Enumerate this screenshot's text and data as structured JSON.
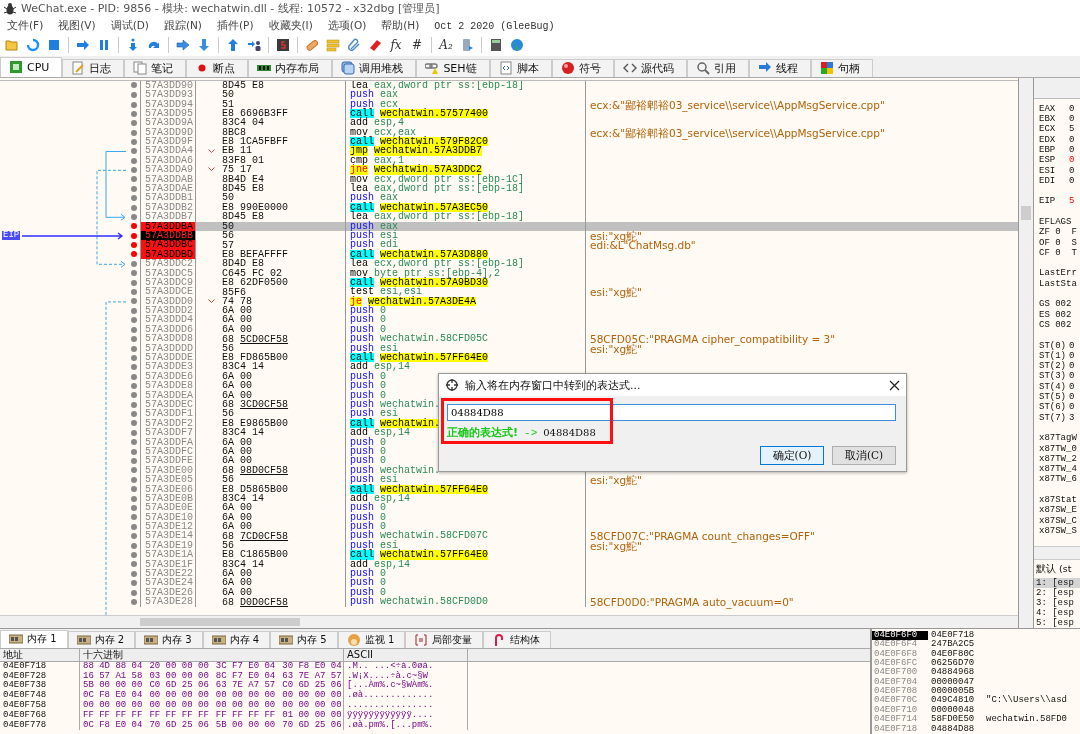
{
  "window": {
    "title": "WeChat.exe - PID: 9856 - 模块: wechatwin.dll - 线程: 10572 - x32dbg [管理员]"
  },
  "menu": [
    "文件(F)",
    "视图(V)",
    "调试(D)",
    "跟踪(N)",
    "插件(P)",
    "收藏夹(I)",
    "选项(O)",
    "帮助(H)"
  ],
  "build": "Oct 2 2020 (GleeBug)",
  "toolbar": [
    {
      "kind": "open"
    },
    {
      "kind": "restart"
    },
    {
      "kind": "stop"
    },
    {
      "kind": "sep"
    },
    {
      "kind": "run"
    },
    {
      "kind": "pause"
    },
    {
      "kind": "sep"
    },
    {
      "kind": "stepinto"
    },
    {
      "kind": "stepover"
    },
    {
      "kind": "sep"
    },
    {
      "kind": "traceinto"
    },
    {
      "kind": "traceover"
    },
    {
      "kind": "sep"
    },
    {
      "kind": "return"
    },
    {
      "kind": "user"
    },
    {
      "kind": "sep"
    },
    {
      "kind": "scriptbox"
    },
    {
      "kind": "sep"
    },
    {
      "kind": "patch"
    },
    {
      "kind": "comments"
    },
    {
      "kind": "labels"
    },
    {
      "kind": "bookmarks"
    },
    {
      "kind": "glyph",
      "label": "fx"
    },
    {
      "kind": "glyph",
      "label": "#"
    },
    {
      "kind": "sep"
    },
    {
      "kind": "glyph",
      "label": "A₂"
    },
    {
      "kind": "device"
    },
    {
      "kind": "sep"
    },
    {
      "kind": "calculator"
    },
    {
      "kind": "globe"
    }
  ],
  "tabs": [
    {
      "label": "CPU",
      "kind": "cpu",
      "selected": true
    },
    {
      "label": "日志",
      "kind": "log",
      "selected": false
    },
    {
      "label": "笔记",
      "kind": "notes",
      "selected": false
    },
    {
      "label": "断点",
      "kind": "breakpoints",
      "selected": false
    },
    {
      "label": "内存布局",
      "kind": "memmap",
      "selected": false
    },
    {
      "label": "调用堆栈",
      "kind": "callstack",
      "selected": false
    },
    {
      "label": "SEH链",
      "kind": "seh",
      "selected": false
    },
    {
      "label": "脚本",
      "kind": "script",
      "selected": false
    },
    {
      "label": "符号",
      "kind": "symbols",
      "selected": false
    },
    {
      "label": "源代码",
      "kind": "source",
      "selected": false
    },
    {
      "label": "引用",
      "kind": "references",
      "selected": false
    },
    {
      "label": "线程",
      "kind": "threads",
      "selected": false
    },
    {
      "label": "句柄",
      "kind": "handles",
      "selected": false
    }
  ],
  "disassembly": {
    "eip_label": "EIP",
    "rows": [
      {
        "address": "57A3DD90",
        "bytes": "8D45 E8",
        "mnemonic": "lea",
        "operands": "eax,dword ptr ss:[ebp-18]",
        "kind": "plain",
        "breakpoint": false,
        "selected": false,
        "eip": false
      },
      {
        "address": "57A3DD93",
        "bytes": "50",
        "mnemonic": "push",
        "operands": "eax",
        "kind": "push",
        "breakpoint": false,
        "selected": false,
        "eip": false
      },
      {
        "address": "57A3DD94",
        "bytes": "51",
        "mnemonic": "push",
        "operands": "ecx",
        "kind": "push",
        "breakpoint": false,
        "selected": false,
        "eip": false,
        "comment": "ecx:&\"鄙裕郫裕03_service\\\\service\\\\AppMsgService.cpp\""
      },
      {
        "address": "57A3DD95",
        "bytes": "E8 6696B3FF",
        "mnemonic": "call",
        "operands": "wechatwin.57577400",
        "kind": "call",
        "breakpoint": false,
        "selected": false,
        "eip": false
      },
      {
        "address": "57A3DD9A",
        "bytes": "83C4 04",
        "mnemonic": "add",
        "operands": "esp,4",
        "kind": "plain",
        "breakpoint": false,
        "selected": false,
        "eip": false
      },
      {
        "address": "57A3DD9D",
        "bytes": "8BC8",
        "mnemonic": "mov",
        "operands": "ecx,eax",
        "kind": "plain",
        "breakpoint": false,
        "selected": false,
        "eip": false,
        "comment": "ecx:&\"鄙裕郫裕03_service\\\\service\\\\AppMsgService.cpp\""
      },
      {
        "address": "57A3DD9F",
        "bytes": "E8 1CA5FBFF",
        "mnemonic": "call",
        "operands": "wechatwin.579F82C0",
        "kind": "call",
        "breakpoint": false,
        "selected": false,
        "eip": false
      },
      {
        "address": "57A3DDA4",
        "bytes": "EB 11",
        "mnemonic": "jmp",
        "operands": "wechatwin.57A3DDB7",
        "kind": "jmp",
        "breakpoint": false,
        "selected": false,
        "eip": false
      },
      {
        "address": "57A3DDA6",
        "bytes": "83F8 01",
        "mnemonic": "cmp",
        "operands": "eax,1",
        "kind": "plain",
        "breakpoint": false,
        "selected": false,
        "eip": false
      },
      {
        "address": "57A3DDA9",
        "bytes": "75 17",
        "mnemonic": "jne",
        "operands": "wechatwin.57A3DDC2",
        "kind": "jcc",
        "breakpoint": false,
        "selected": false,
        "eip": false
      },
      {
        "address": "57A3DDAB",
        "bytes": "8B4D E4",
        "mnemonic": "mov",
        "operands": "ecx,dword ptr ss:[ebp-1C]",
        "kind": "plain",
        "breakpoint": false,
        "selected": false,
        "eip": false
      },
      {
        "address": "57A3DDAE",
        "bytes": "8D45 E8",
        "mnemonic": "lea",
        "operands": "eax,dword ptr ss:[ebp-18]",
        "kind": "plain",
        "breakpoint": false,
        "selected": false,
        "eip": false
      },
      {
        "address": "57A3DDB1",
        "bytes": "50",
        "mnemonic": "push",
        "operands": "eax",
        "kind": "push",
        "breakpoint": false,
        "selected": false,
        "eip": false
      },
      {
        "address": "57A3DDB2",
        "bytes": "E8 990E0000",
        "mnemonic": "call",
        "operands": "wechatwin.57A3EC50",
        "kind": "call",
        "breakpoint": false,
        "selected": false,
        "eip": false
      },
      {
        "address": "57A3DDB7",
        "bytes": "8D45 E8",
        "mnemonic": "lea",
        "operands": "eax,dword ptr ss:[ebp-18]",
        "kind": "plain",
        "breakpoint": false,
        "selected": false,
        "eip": false
      },
      {
        "address": "57A3DDBA",
        "bytes": "50",
        "mnemonic": "push",
        "operands": "eax",
        "kind": "push",
        "breakpoint": true,
        "selected": true,
        "eip": false
      },
      {
        "address": "57A3DDBB",
        "bytes": "56",
        "mnemonic": "push",
        "operands": "esi",
        "kind": "push",
        "breakpoint": true,
        "selected": false,
        "eip": true,
        "comment": "esi:\"xg鮀\""
      },
      {
        "address": "57A3DDBC",
        "bytes": "57",
        "mnemonic": "push",
        "operands": "edi",
        "kind": "push",
        "breakpoint": true,
        "selected": false,
        "eip": false,
        "comment": "edi:&L\"ChatMsg.db\""
      },
      {
        "address": "57A3DDBD",
        "bytes": "E8 BEFAFFFF",
        "mnemonic": "call",
        "operands": "wechatwin.57A3D880",
        "kind": "call",
        "breakpoint": true,
        "selected": false,
        "eip": false
      },
      {
        "address": "57A3DDC2",
        "bytes": "8D4D E8",
        "mnemonic": "lea",
        "operands": "ecx,dword ptr ss:[ebp-18]",
        "kind": "plain",
        "breakpoint": false,
        "selected": false,
        "eip": false
      },
      {
        "address": "57A3DDC5",
        "bytes": "C645 FC 02",
        "mnemonic": "mov",
        "operands": "byte ptr ss:[ebp-4],2",
        "kind": "plain",
        "breakpoint": false,
        "selected": false,
        "eip": false
      },
      {
        "address": "57A3DDC9",
        "bytes": "E8 62DF0500",
        "mnemonic": "call",
        "operands": "wechatwin.57A9BD30",
        "kind": "call",
        "breakpoint": false,
        "selected": false,
        "eip": false
      },
      {
        "address": "57A3DDCE",
        "bytes": "85F6",
        "mnemonic": "test",
        "operands": "esi,esi",
        "kind": "plain",
        "breakpoint": false,
        "selected": false,
        "eip": false,
        "comment": "esi:\"xg鮀\""
      },
      {
        "address": "57A3DDD0",
        "bytes": "74 78",
        "mnemonic": "je",
        "operands": "wechatwin.57A3DE4A",
        "kind": "jcc",
        "breakpoint": false,
        "selected": false,
        "eip": false
      },
      {
        "address": "57A3DDD2",
        "bytes": "6A 00",
        "mnemonic": "push",
        "operands": "0",
        "kind": "push",
        "breakpoint": false,
        "selected": false,
        "eip": false
      },
      {
        "address": "57A3DDD4",
        "bytes": "6A 00",
        "mnemonic": "push",
        "operands": "0",
        "kind": "push",
        "breakpoint": false,
        "selected": false,
        "eip": false
      },
      {
        "address": "57A3DDD6",
        "bytes": "6A 00",
        "mnemonic": "push",
        "operands": "0",
        "kind": "push",
        "breakpoint": false,
        "selected": false,
        "eip": false
      },
      {
        "address": "57A3DDD8",
        "bytes": "68",
        "bytes_ref": "5CD0CF58",
        "mnemonic": "push",
        "operands": "wechatwin.58CFD05C",
        "kind": "push",
        "breakpoint": false,
        "selected": false,
        "eip": false,
        "comment": "58CFD05C:\"PRAGMA cipher_compatibility = 3\""
      },
      {
        "address": "57A3DDDD",
        "bytes": "56",
        "mnemonic": "push",
        "operands": "esi",
        "kind": "push",
        "breakpoint": false,
        "selected": false,
        "eip": false,
        "comment": "esi:\"xg鮀\""
      },
      {
        "address": "57A3DDDE",
        "bytes": "E8 FD865B00",
        "mnemonic": "call",
        "operands": "wechatwin.57FF64E0",
        "kind": "call",
        "breakpoint": false,
        "selected": false,
        "eip": false
      },
      {
        "address": "57A3DDE3",
        "bytes": "83C4 14",
        "mnemonic": "add",
        "operands": "esp,14",
        "kind": "plain",
        "breakpoint": false,
        "selected": false,
        "eip": false
      },
      {
        "address": "57A3DDE6",
        "bytes": "6A 00",
        "mnemonic": "push",
        "operands": "0",
        "kind": "push",
        "breakpoint": false,
        "selected": false,
        "eip": false
      },
      {
        "address": "57A3DDE8",
        "bytes": "6A 00",
        "mnemonic": "push",
        "operands": "0",
        "kind": "push",
        "breakpoint": false,
        "selected": false,
        "eip": false
      },
      {
        "address": "57A3DDEA",
        "bytes": "6A 00",
        "mnemonic": "push",
        "operands": "0",
        "kind": "push",
        "breakpoint": false,
        "selected": false,
        "eip": false
      },
      {
        "address": "57A3DDEC",
        "bytes": "68",
        "bytes_ref": "3CD0CF58",
        "mnemonic": "push",
        "operands": "wechatwin.",
        "kind": "push",
        "breakpoint": false,
        "selected": false,
        "eip": false
      },
      {
        "address": "57A3DDF1",
        "bytes": "56",
        "mnemonic": "push",
        "operands": "esi",
        "kind": "push",
        "breakpoint": false,
        "selected": false,
        "eip": false
      },
      {
        "address": "57A3DDF2",
        "bytes": "E8 E9865B00",
        "mnemonic": "call",
        "operands": "wechatwin.",
        "kind": "call",
        "breakpoint": false,
        "selected": false,
        "eip": false
      },
      {
        "address": "57A3DDF7",
        "bytes": "83C4 14",
        "mnemonic": "add",
        "operands": "esp,14",
        "kind": "plain",
        "breakpoint": false,
        "selected": false,
        "eip": false
      },
      {
        "address": "57A3DDFA",
        "bytes": "6A 00",
        "mnemonic": "push",
        "operands": "0",
        "kind": "push",
        "breakpoint": false,
        "selected": false,
        "eip": false
      },
      {
        "address": "57A3DDFC",
        "bytes": "6A 00",
        "mnemonic": "push",
        "operands": "0",
        "kind": "push",
        "breakpoint": false,
        "selected": false,
        "eip": false
      },
      {
        "address": "57A3DDFE",
        "bytes": "6A 00",
        "mnemonic": "push",
        "operands": "0",
        "kind": "push",
        "breakpoint": false,
        "selected": false,
        "eip": false
      },
      {
        "address": "57A3DE00",
        "bytes": "68",
        "bytes_ref": "98D0CF58",
        "mnemonic": "push",
        "operands": "wechatwin.",
        "kind": "push",
        "breakpoint": false,
        "selected": false,
        "eip": false
      },
      {
        "address": "57A3DE05",
        "bytes": "56",
        "mnemonic": "push",
        "operands": "esi",
        "kind": "push",
        "breakpoint": false,
        "selected": false,
        "eip": false,
        "comment": "esi:\"xg鮀\""
      },
      {
        "address": "57A3DE06",
        "bytes": "E8 D5865B00",
        "mnemonic": "call",
        "operands": "wechatwin.57FF64E0",
        "kind": "call",
        "breakpoint": false,
        "selected": false,
        "eip": false
      },
      {
        "address": "57A3DE0B",
        "bytes": "83C4 14",
        "mnemonic": "add",
        "operands": "esp,14",
        "kind": "plain",
        "breakpoint": false,
        "selected": false,
        "eip": false
      },
      {
        "address": "57A3DE0E",
        "bytes": "6A 00",
        "mnemonic": "push",
        "operands": "0",
        "kind": "push",
        "breakpoint": false,
        "selected": false,
        "eip": false
      },
      {
        "address": "57A3DE10",
        "bytes": "6A 00",
        "mnemonic": "push",
        "operands": "0",
        "kind": "push",
        "breakpoint": false,
        "selected": false,
        "eip": false
      },
      {
        "address": "57A3DE12",
        "bytes": "6A 00",
        "mnemonic": "push",
        "operands": "0",
        "kind": "push",
        "breakpoint": false,
        "selected": false,
        "eip": false
      },
      {
        "address": "57A3DE14",
        "bytes": "68",
        "bytes_ref": "7CD0CF58",
        "mnemonic": "push",
        "operands": "wechatwin.58CFD07C",
        "kind": "push",
        "breakpoint": false,
        "selected": false,
        "eip": false,
        "comment": "58CFD07C:\"PRAGMA count_changes=OFF\""
      },
      {
        "address": "57A3DE19",
        "bytes": "56",
        "mnemonic": "push",
        "operands": "esi",
        "kind": "push",
        "breakpoint": false,
        "selected": false,
        "eip": false,
        "comment": "esi:\"xg鮀\""
      },
      {
        "address": "57A3DE1A",
        "bytes": "E8 C1865B00",
        "mnemonic": "call",
        "operands": "wechatwin.57FF64E0",
        "kind": "call",
        "breakpoint": false,
        "selected": false,
        "eip": false
      },
      {
        "address": "57A3DE1F",
        "bytes": "83C4 14",
        "mnemonic": "add",
        "operands": "esp,14",
        "kind": "plain",
        "breakpoint": false,
        "selected": false,
        "eip": false
      },
      {
        "address": "57A3DE22",
        "bytes": "6A 00",
        "mnemonic": "push",
        "operands": "0",
        "kind": "push",
        "breakpoint": false,
        "selected": false,
        "eip": false
      },
      {
        "address": "57A3DE24",
        "bytes": "6A 00",
        "mnemonic": "push",
        "operands": "0",
        "kind": "push",
        "breakpoint": false,
        "selected": false,
        "eip": false
      },
      {
        "address": "57A3DE26",
        "bytes": "6A 00",
        "mnemonic": "push",
        "operands": "0",
        "kind": "push",
        "breakpoint": false,
        "selected": false,
        "eip": false
      },
      {
        "address": "57A3DE28",
        "bytes": "68",
        "bytes_ref": "D0D0CF58",
        "mnemonic": "push",
        "operands": "wechatwin.58CFD0D0",
        "kind": "push",
        "breakpoint": false,
        "selected": false,
        "eip": false,
        "comment": "58CFD0D0:\"PRAGMA auto_vacuum=0\""
      }
    ]
  },
  "registers": [
    [
      {
        "name": "EAX",
        "value": "0",
        "changed": false
      },
      {
        "name": "EBX",
        "value": "0",
        "changed": false
      },
      {
        "name": "ECX",
        "value": "5",
        "changed": false
      },
      {
        "name": "EDX",
        "value": "0",
        "changed": false
      },
      {
        "name": "EBP",
        "value": "0",
        "changed": false
      },
      {
        "name": "ESP",
        "value": "0",
        "changed": true
      },
      {
        "name": "ESI",
        "value": "0",
        "changed": false
      },
      {
        "name": "EDI",
        "value": "0",
        "changed": false
      }
    ],
    [
      {
        "name": "EIP",
        "value": "5",
        "changed": true
      }
    ],
    [
      {
        "name": "EFLAGS"
      },
      {
        "name": "ZF 0  F"
      },
      {
        "name": "OF 0  S"
      },
      {
        "name": "CF 0  T"
      }
    ],
    [
      {
        "name": "LastErr"
      },
      {
        "name": "LastSta"
      }
    ],
    [
      {
        "name": "GS 002"
      },
      {
        "name": "ES 002"
      },
      {
        "name": "CS 002"
      }
    ],
    [
      {
        "name": "ST(0)",
        "value": "0",
        "changed": false
      },
      {
        "name": "ST(1)",
        "value": "0",
        "changed": false
      },
      {
        "name": "ST(2)",
        "value": "0",
        "changed": false
      },
      {
        "name": "ST(3)",
        "value": "0",
        "changed": false
      },
      {
        "name": "ST(4)",
        "value": "0",
        "changed": false
      },
      {
        "name": "ST(5)",
        "value": "0",
        "changed": false
      },
      {
        "name": "ST(6)",
        "value": "0",
        "changed": false
      },
      {
        "name": "ST(7)",
        "value": "3",
        "changed": false
      }
    ],
    [
      {
        "name": "x87TagW"
      },
      {
        "name": "x87TW_0"
      },
      {
        "name": "x87TW_2"
      },
      {
        "name": "x87TW_4"
      },
      {
        "name": "x87TW_6"
      }
    ],
    [
      {
        "name": "x87Stat"
      },
      {
        "name": "x87SW_E"
      },
      {
        "name": "x87SW_C"
      },
      {
        "name": "x87SW_S"
      }
    ]
  ],
  "call_args": {
    "title": "默认 (st",
    "items": [
      {
        "text": "1: [esp",
        "selected": true
      },
      {
        "text": "2: [esp",
        "selected": false
      },
      {
        "text": "3: [esp",
        "selected": false
      },
      {
        "text": "4: [esp",
        "selected": false
      },
      {
        "text": "5: [esp",
        "selected": false
      }
    ]
  },
  "dialog": {
    "title": "输入将在内存窗口中转到的表达式...",
    "value": "04884D88",
    "status": "正确的表达式!",
    "arrow": "->",
    "result": "04884D88",
    "buttons": [
      {
        "label": "确定(O)",
        "default": true
      },
      {
        "label": "取消(C)",
        "default": false
      }
    ]
  },
  "bottom_tabs": [
    {
      "label": "内存 1",
      "kind": "memory",
      "selected": true
    },
    {
      "label": "内存 2",
      "kind": "memory",
      "selected": false
    },
    {
      "label": "内存 3",
      "kind": "memory",
      "selected": false
    },
    {
      "label": "内存 4",
      "kind": "memory",
      "selected": false
    },
    {
      "label": "内存 5",
      "kind": "memory",
      "selected": false
    },
    {
      "label": "监视 1",
      "kind": "watch",
      "selected": false
    },
    {
      "label": "局部变量",
      "kind": "locals",
      "selected": false
    },
    {
      "label": "结构体",
      "kind": "struct",
      "selected": false
    }
  ],
  "dump": {
    "columns": [
      "地址",
      "十六进制",
      "ASCII"
    ],
    "rows": [
      {
        "address": "04E0F718",
        "hex": [
          "88 4D 88 04",
          "20 00 00 00",
          "3C F7 E0 04",
          "30 F8 E0 04"
        ],
        "ascii": ".M.. ...<÷à.0øà."
      },
      {
        "address": "04E0F728",
        "hex": [
          "16 57 A1 58",
          "03 00 00 00",
          "8C F7 E0 04",
          "63 7E A7 57"
        ],
        "ascii": ".W¡X....÷à.c~§W"
      },
      {
        "address": "04E0F738",
        "hex": [
          "5B 00 00 00",
          "C0 6D 25 06",
          "63 7E A7 57",
          "C0 6D 25 06"
        ],
        "ascii": "[...Àm%.c~§WÀm%."
      },
      {
        "address": "04E0F748",
        "hex": [
          "0C F8 E0 04",
          "00 00 00 00",
          "00 00 00 00",
          "00 00 00 00"
        ],
        "ascii": ".øà............."
      },
      {
        "address": "04E0F758",
        "hex": [
          "00 00 00 00",
          "00 00 00 00",
          "00 00 00 00",
          "00 00 00 00"
        ],
        "ascii": "................"
      },
      {
        "address": "04E0F768",
        "hex": [
          "FF FF FF FF",
          "FF FF FF FF",
          "FF FF FF FF",
          "01 00 00 00"
        ],
        "ascii": "ÿÿÿÿÿÿÿÿÿÿÿÿ...."
      },
      {
        "address": "04E0F778",
        "hex": [
          "0C F8 E0 04",
          "70 6D 25 06",
          "5B 00 00 00",
          "70 6D 25 06"
        ],
        "ascii": ".øà.pm%.[...pm%."
      }
    ]
  },
  "stack": [
    {
      "address": "04E0F6F0",
      "value": "04E0F718",
      "selected": true
    },
    {
      "address": "04E0F6F4",
      "value": "247BA2C5",
      "selected": false
    },
    {
      "address": "04E0F6F8",
      "value": "04E0F80C",
      "selected": false
    },
    {
      "address": "04E0F6FC",
      "value": "06256D70",
      "selected": false
    },
    {
      "address": "04E0F700",
      "value": "04884968",
      "selected": false
    },
    {
      "address": "04E0F704",
      "value": "00000047",
      "selected": false
    },
    {
      "address": "04E0F708",
      "value": "0000005B",
      "selected": false
    },
    {
      "address": "04E0F70C",
      "value": "049C4810",
      "selected": false,
      "comment": "\"C:\\\\Users\\\\asd"
    },
    {
      "address": "04E0F710",
      "value": "00000048",
      "selected": false
    },
    {
      "address": "04E0F714",
      "value": "58FD0E50",
      "selected": false,
      "comment": "wechatwin.58FD0"
    },
    {
      "address": "04E0F718",
      "value": "04884D88",
      "selected": false
    }
  ]
}
